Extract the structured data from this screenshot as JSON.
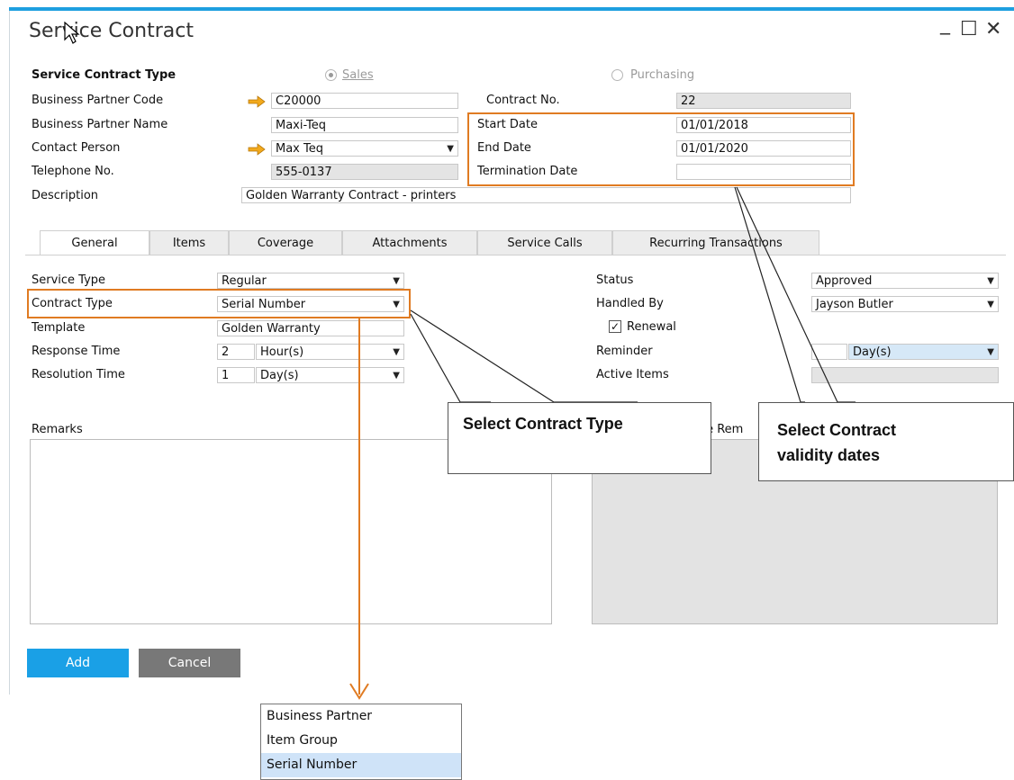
{
  "window": {
    "title": "Service Contract",
    "minimize": "_",
    "maximize": "☐",
    "close": "✕"
  },
  "header": {
    "contract_type_label": "Service Contract Type",
    "radio_sales": "Sales",
    "radio_purchasing": "Purchasing",
    "bp_code_label": "Business Partner Code",
    "bp_code_value": "C20000",
    "bp_name_label": "Business Partner Name",
    "bp_name_value": "Maxi-Teq",
    "contact_label": "Contact Person",
    "contact_value": "Max Teq",
    "phone_label": "Telephone No.",
    "phone_value": "555-0137",
    "description_label": "Description",
    "description_value": "Golden Warranty Contract - printers",
    "contract_no_label": "Contract No.",
    "contract_no_value": "22",
    "start_date_label": "Start Date",
    "start_date_value": "01/01/2018",
    "end_date_label": "End Date",
    "end_date_value": "01/01/2020",
    "termination_label": "Termination Date",
    "termination_value": ""
  },
  "tabs": [
    "General",
    "Items",
    "Coverage",
    "Attachments",
    "Service Calls",
    "Recurring Transactions"
  ],
  "general": {
    "service_type_label": "Service Type",
    "service_type_value": "Regular",
    "contract_type_label": "Contract Type",
    "contract_type_value": "Serial Number",
    "template_label": "Template",
    "template_value": "Golden Warranty",
    "response_label": "Response Time",
    "response_value": "2",
    "response_unit": "Hour(s)",
    "resolution_label": "Resolution Time",
    "resolution_value": "1",
    "resolution_unit": "Day(s)",
    "status_label": "Status",
    "status_value": "Approved",
    "handled_label": "Handled By",
    "handled_value": "Jayson Butler",
    "renewal_label": "Renewal",
    "renewal_checked": true,
    "reminder_label": "Reminder",
    "reminder_unit": "Day(s)",
    "active_items_label": "Active Items",
    "remarks_label": "Remarks",
    "template_remarks_label_visible": "te Rem"
  },
  "buttons": {
    "add": "Add",
    "cancel": "Cancel"
  },
  "callouts": {
    "contract_type": "Select Contract Type",
    "validity_line1": "Select Contract",
    "validity_line2": "validity dates"
  },
  "dropdown_options": [
    "Business Partner",
    "Item Group",
    "Serial Number"
  ],
  "colors": {
    "accent": "#1e9fe0",
    "highlight": "#e07b22",
    "add_button": "#1aa0e6",
    "cancel_button": "#787878"
  }
}
